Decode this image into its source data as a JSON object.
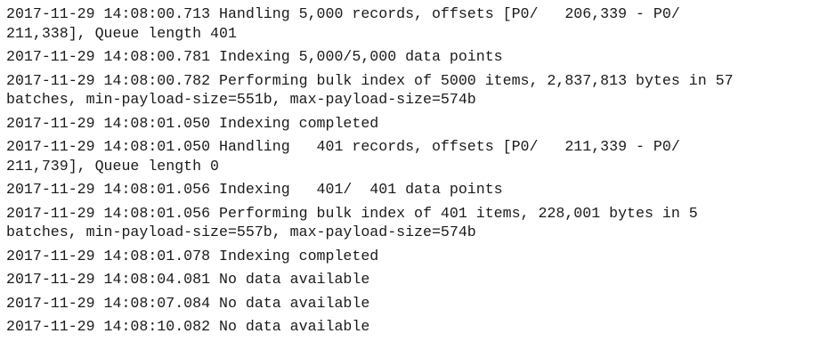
{
  "log": {
    "entries": [
      "2017-11-29 14:08:00.713 Handling 5,000 records, offsets [P0/   206,339 - P0/\n211,338], Queue length 401",
      "2017-11-29 14:08:00.781 Indexing 5,000/5,000 data points",
      "2017-11-29 14:08:00.782 Performing bulk index of 5000 items, 2,837,813 bytes in 57\nbatches, min-payload-size=551b, max-payload-size=574b",
      "2017-11-29 14:08:01.050 Indexing completed",
      "2017-11-29 14:08:01.050 Handling   401 records, offsets [P0/   211,339 - P0/\n211,739], Queue length 0",
      "2017-11-29 14:08:01.056 Indexing   401/  401 data points",
      "2017-11-29 14:08:01.056 Performing bulk index of 401 items, 228,001 bytes in 5\nbatches, min-payload-size=557b, max-payload-size=574b",
      "2017-11-29 14:08:01.078 Indexing completed",
      "2017-11-29 14:08:04.081 No data available",
      "2017-11-29 14:08:07.084 No data available",
      "2017-11-29 14:08:10.082 No data available"
    ]
  }
}
